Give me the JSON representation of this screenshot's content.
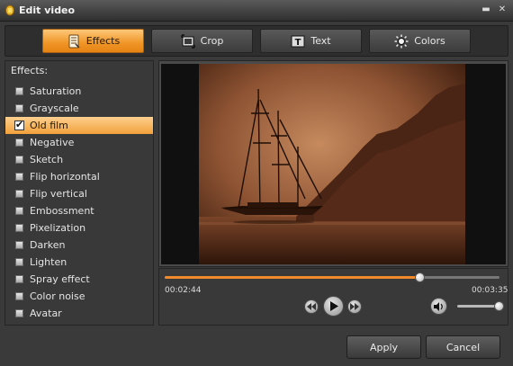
{
  "window": {
    "title": "Edit video",
    "icons": {
      "app": "app-logo-icon",
      "minimize": "minimize-icon",
      "close": "close-icon"
    },
    "minimize_glyph": "▬",
    "close_glyph": "✕"
  },
  "tabs": [
    {
      "label": "Effects",
      "icon": "effects-icon",
      "active": true
    },
    {
      "label": "Crop",
      "icon": "crop-icon",
      "active": false
    },
    {
      "label": "Text",
      "icon": "text-icon",
      "active": false
    },
    {
      "label": "Colors",
      "icon": "colors-icon",
      "active": false
    }
  ],
  "effects": {
    "heading": "Effects:",
    "items": [
      {
        "label": "Saturation",
        "checked": false
      },
      {
        "label": "Grayscale",
        "checked": false
      },
      {
        "label": "Old film",
        "checked": true
      },
      {
        "label": "Negative",
        "checked": false
      },
      {
        "label": "Sketch",
        "checked": false
      },
      {
        "label": "Flip horizontal",
        "checked": false
      },
      {
        "label": "Flip vertical",
        "checked": false
      },
      {
        "label": "Embossment",
        "checked": false
      },
      {
        "label": "Pixelization",
        "checked": false
      },
      {
        "label": "Darken",
        "checked": false
      },
      {
        "label": "Lighten",
        "checked": false
      },
      {
        "label": "Spray effect",
        "checked": false
      },
      {
        "label": "Color noise",
        "checked": false
      },
      {
        "label": "Avatar",
        "checked": false
      }
    ]
  },
  "player": {
    "current_time": "00:02:44",
    "total_time": "00:03:35",
    "progress": 0.763,
    "volume": 1.0,
    "check_glyph": "✔",
    "icons": {
      "previous": "previous-icon",
      "play": "play-icon",
      "next": "next-icon",
      "volume": "volume-icon"
    }
  },
  "colors": {
    "accent": "#f2a03a",
    "progress": "#f08a2a",
    "background": "#3a3a3a"
  },
  "buttons": {
    "apply": "Apply",
    "cancel": "Cancel"
  }
}
